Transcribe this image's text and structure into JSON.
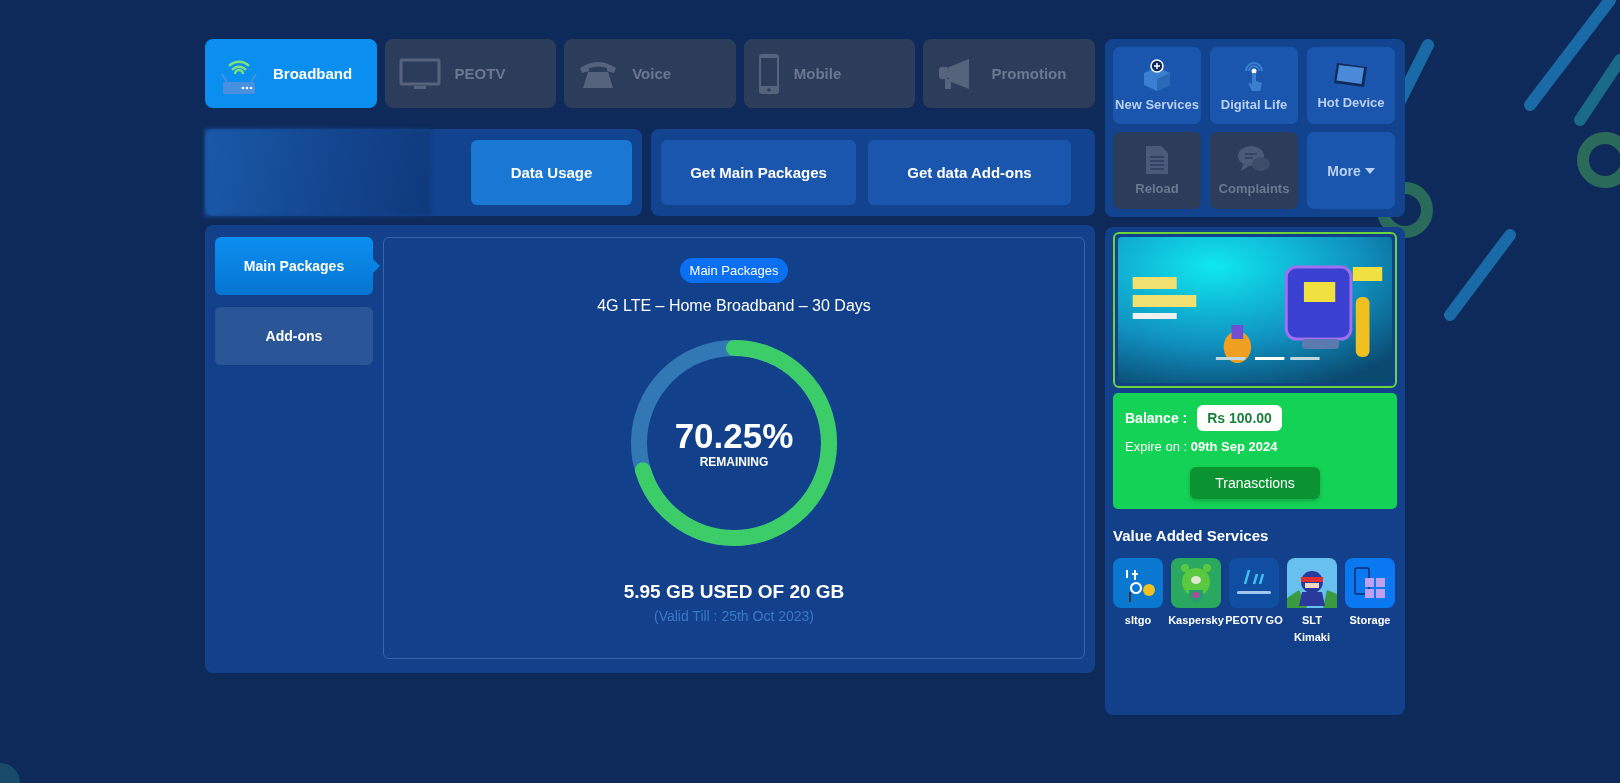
{
  "service_tabs": [
    {
      "label": "Broadband",
      "selected": true
    },
    {
      "label": "PEOTV",
      "selected": false
    },
    {
      "label": "Voice",
      "selected": false
    },
    {
      "label": "Mobile",
      "selected": false
    },
    {
      "label": "Promotion",
      "selected": false
    }
  ],
  "actions": {
    "left": [
      "Data Usage"
    ],
    "right": [
      "Get Main Packages",
      "Get data Add-ons"
    ]
  },
  "package_tabs": [
    {
      "label": "Main Packages",
      "selected": true
    },
    {
      "label": "Add-ons",
      "selected": false
    }
  ],
  "usage": {
    "badge": "Main Packages",
    "package_name": "4G LTE – Home Broadband – 30 Days",
    "percent": "70.25%",
    "caption": "REMAINING",
    "level": 0.7025,
    "used": "5.95 GB USED OF 20 GB",
    "valid_till": "(Valid Till : 25th Oct 2023)"
  },
  "quick_links": [
    {
      "label": "New Services",
      "disabled": false
    },
    {
      "label": "Digital Life",
      "disabled": false
    },
    {
      "label": "Hot Device",
      "disabled": false
    },
    {
      "label": "Reload",
      "disabled": true
    },
    {
      "label": "Complaints",
      "disabled": true
    },
    {
      "label": "More",
      "disabled": false,
      "kind": "dropdown"
    }
  ],
  "balance": {
    "label": "Balance :",
    "amount": "Rs 100.00",
    "expire_label": "Expire on :",
    "expire_date": "09th Sep 2024",
    "button": "Tranasctions"
  },
  "value_added_services": {
    "title": "Value Added Services",
    "apps": [
      {
        "label": "sltgo"
      },
      {
        "label": "Kaspersky"
      },
      {
        "label": "PEOTV GO"
      },
      {
        "label": "SLT Kimaki"
      },
      {
        "label": "Storage"
      }
    ]
  }
}
